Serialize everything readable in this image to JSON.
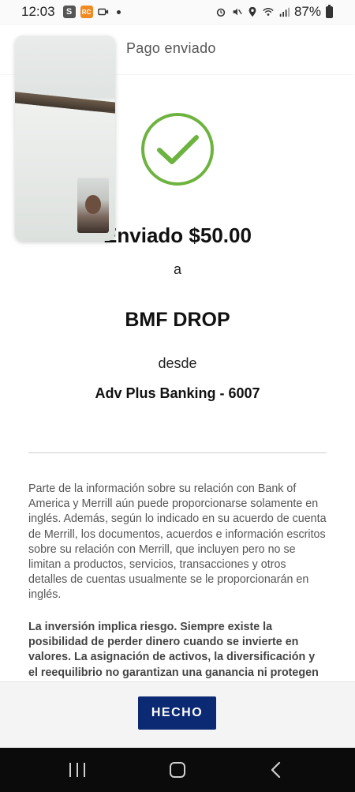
{
  "status_bar": {
    "time": "12:03",
    "s_badge": "S",
    "app_badge": "RC",
    "battery": "87%"
  },
  "header": {
    "title": "Pago enviado"
  },
  "confirmation": {
    "sent_amount": "Enviado $50.00",
    "to_word": "a",
    "recipient": "BMF DROP",
    "from_word": "desde",
    "account": "Adv Plus Banking - 6007"
  },
  "disclaimer": "Parte de la información sobre su relación con Bank of America y Merrill aún puede proporcionarse solamente en inglés. Además, según lo indicado en su acuerdo de cuenta de Merrill, los documentos, acuerdos e información escritos sobre su relación con Merrill, que incluyen pero no se limitan a productos, servicios, transacciones y otros detalles de cuentas usualmente se le proporcionarán en inglés.",
  "risk_notice": "La inversión implica riesgo. Siempre existe la posibilidad de perder dinero cuando se invierte en valores. La asignación de activos, la diversificación y el reequilibrio no garantizan una ganancia ni protegen",
  "footer": {
    "done_label": "HECHO"
  },
  "colors": {
    "success_green": "#6db33f",
    "button_navy": "#0b2a73"
  },
  "icons": {
    "success": "checkmark-circle-icon",
    "recents": "recents-icon",
    "home": "home-icon",
    "back": "back-icon"
  }
}
